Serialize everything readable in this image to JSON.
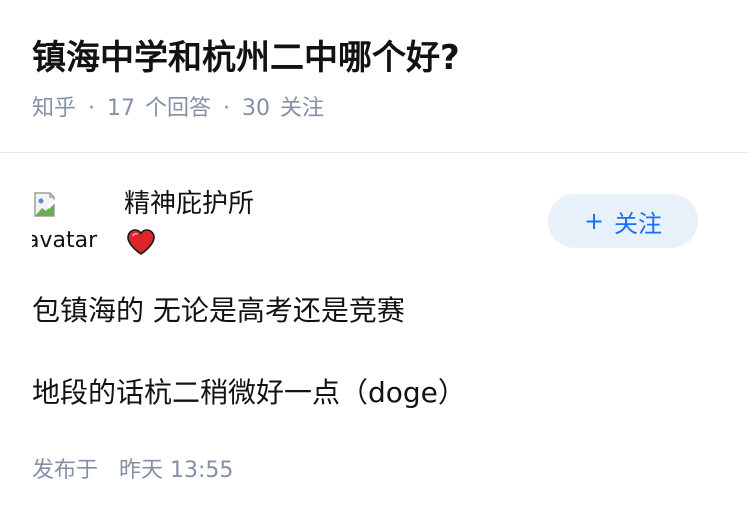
{
  "question": {
    "title": "镇海中学和杭州二中哪个好?",
    "source": "知乎",
    "separator": "·",
    "answer_count": "17",
    "answer_label": "个回答",
    "follower_count": "30",
    "follower_label": "关注"
  },
  "answer": {
    "avatar_alt": "avatar",
    "author_name": "精神庇护所",
    "author_badge_icon": "heart-icon",
    "follow_button": {
      "plus": "+",
      "label": "关注"
    },
    "paragraphs": [
      "包镇海的 无论是高考还是竞赛",
      "地段的话杭二稍微好一点（doge）"
    ],
    "publish_label": "发布于",
    "publish_time": "昨天 13:55"
  },
  "colors": {
    "text": "#121212",
    "meta": "#8590a6",
    "accent": "#1772f6",
    "follow_bg": "#e8f0fa",
    "heart": "#e0242b"
  }
}
